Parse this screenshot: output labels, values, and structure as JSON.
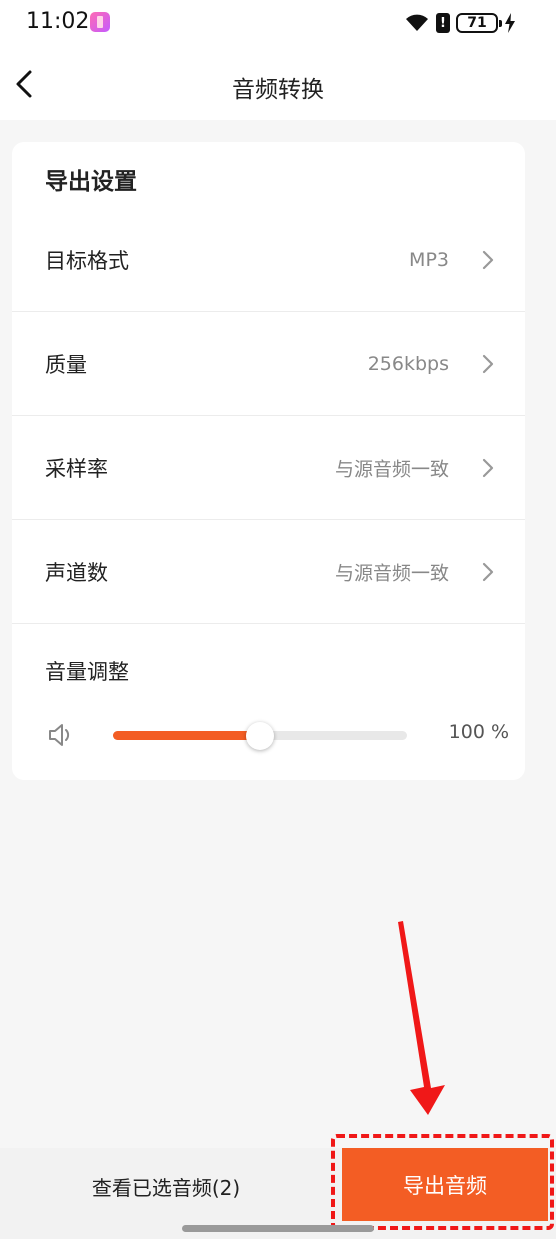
{
  "status_bar": {
    "time": "11:02",
    "battery": "71",
    "alert": "!"
  },
  "header": {
    "title": "音频转换"
  },
  "settings": {
    "title": "导出设置",
    "rows": [
      {
        "label": "目标格式",
        "value": "MP3"
      },
      {
        "label": "质量",
        "value": "256kbps"
      },
      {
        "label": "采样率",
        "value": "与源音频一致"
      },
      {
        "label": "声道数",
        "value": "与源音频一致"
      }
    ],
    "volume": {
      "label": "音量调整",
      "value_text": "100 %",
      "slider_fraction": 0.5
    }
  },
  "footer": {
    "view_selected": "查看已选音频(2)",
    "export": "导出音频"
  },
  "colors": {
    "accent": "#f35d24",
    "highlight": "#f01818"
  }
}
